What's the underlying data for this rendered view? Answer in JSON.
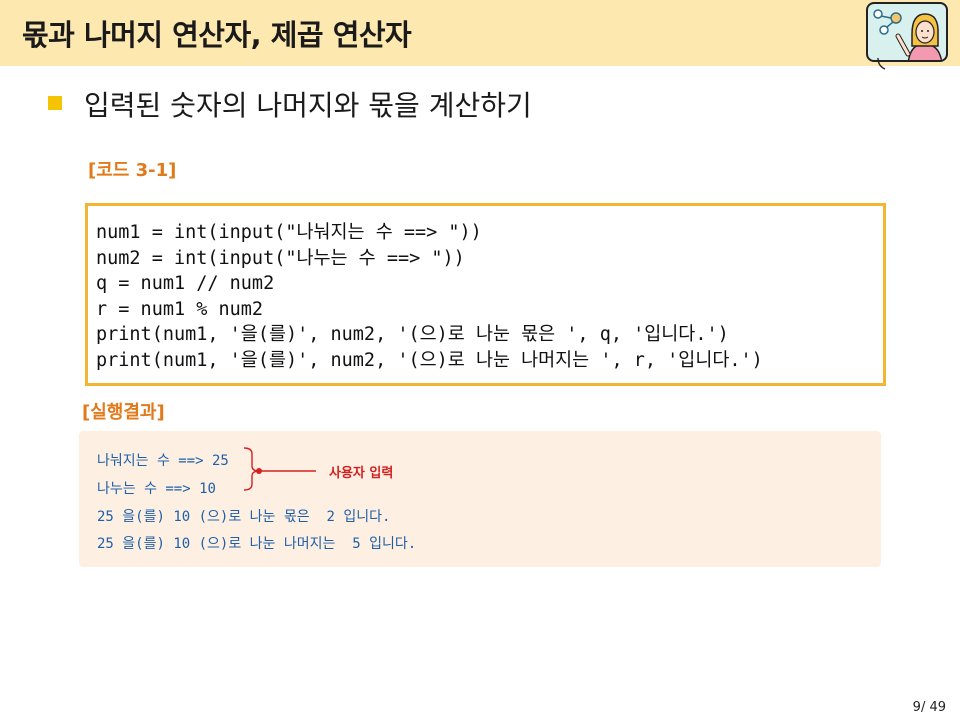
{
  "header": {
    "title": "몫과 나머지 연산자, 제곱 연산자"
  },
  "slide": {
    "subtitle": "입력된 숫자의 나머지와 몫을 계산하기",
    "code_label": "[코드 3-1]",
    "code_lines": [
      "num1 = int(input(\"나눠지는 수 ==> \"))",
      "num2 = int(input(\"나누는 수 ==> \"))",
      "q = num1 // num2",
      "r = num1 % num2",
      "print(num1, '을(를)', num2, '(으)로 나눈 몫은 ', q, '입니다.')",
      "print(num1, '을(를)', num2, '(으)로 나눈 나머지는 ', r, '입니다.')"
    ],
    "result_label": "[실행결과]",
    "result_lines": [
      "나눠지는 수 ==> 25",
      "나누는 수 ==> 10",
      "25 을(를) 10 (으)로 나눈 몫은  2 입니다.",
      "25 을(를) 10 (으)로 나눈 나머지는  5 입니다."
    ],
    "annotation": "사용자 입력",
    "annotation_color": "#d42020",
    "accent_color": "#f2b534",
    "result_text_color": "#1f5fa8"
  },
  "footer": {
    "page_number": "9/ 49"
  }
}
